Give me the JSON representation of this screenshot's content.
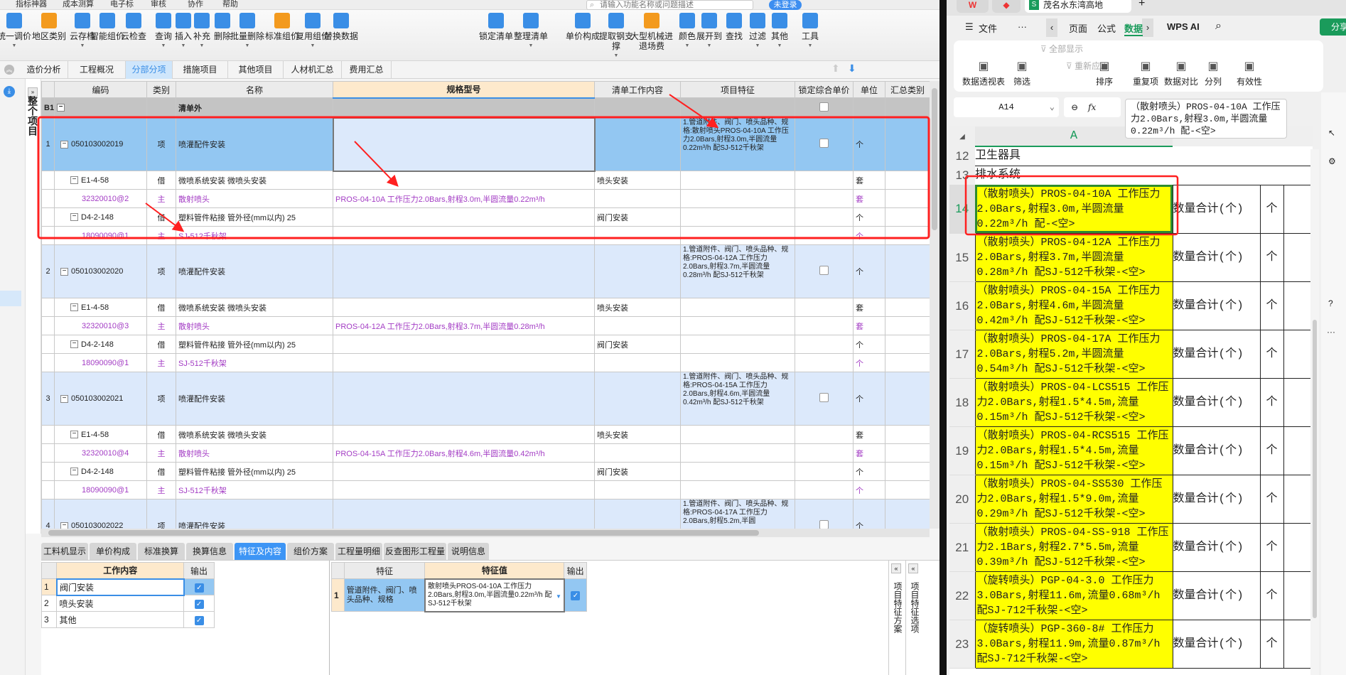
{
  "app": {
    "menu": [
      "指标神器",
      "成本测算",
      "电子标",
      "审核",
      "协作",
      "帮助"
    ],
    "search_placeholder": "请输入功能名称或问题描述",
    "login_label": "未登录",
    "toolbar": [
      "统一调价",
      "地区类别",
      "云存档",
      "智能组价",
      "云检查",
      "查询",
      "插入",
      "补充",
      "删除",
      "批量删除",
      "标准组价",
      "复用组价",
      "替换数据",
      "锁定清单",
      "整理清单",
      "单价构成",
      "提取钢支撑",
      "大型机械进退场费",
      "颜色",
      "展开到",
      "查找",
      "过滤",
      "其他",
      "工具"
    ],
    "tabs": [
      "造价分析",
      "工程概况",
      "分部分项",
      "措施项目",
      "其他项目",
      "人材机汇总",
      "费用汇总"
    ],
    "active_tab": "分部分项",
    "side_label": "整个项目",
    "grid": {
      "columns": [
        "",
        "编码",
        "类别",
        "名称",
        "规格型号",
        "清单工作内容",
        "项目特征",
        "锁定综合单价",
        "单位",
        "汇总类别"
      ],
      "section": {
        "no": "B1",
        "name": "清单外"
      },
      "items": [
        {
          "no": "1",
          "code": "050103002019",
          "type": "项",
          "name": "喷灌配件安装",
          "feature": "1.管道附件、阀门、喷头品种、规格:散射喷头PROS-04-10A 工作压力2.0Bars,射程3.0m,半圆流量0.22m³/h 配SJ-512千秋架",
          "unit": "个",
          "selected": true,
          "children": [
            {
              "code": "E1-4-58",
              "type": "借",
              "name": "微喷系统安装 微喷头安装",
              "spec": "",
              "work": "喷头安装",
              "unit": "套",
              "main": false
            },
            {
              "code": "32320010@2",
              "type": "主",
              "name": "散射喷头",
              "spec": "PROS-04-10A 工作压力2.0Bars,射程3.0m,半圆流量0.22m³/h",
              "work": "",
              "unit": "套",
              "main": true
            },
            {
              "code": "D4-2-148",
              "type": "借",
              "name": "塑料管件粘接 管外径(mm以内) 25",
              "spec": "",
              "work": "阀门安装",
              "unit": "个",
              "main": false
            },
            {
              "code": "18090090@1",
              "type": "主",
              "name": "SJ-512千秋架",
              "spec": "",
              "work": "",
              "unit": "个",
              "main": true
            }
          ]
        },
        {
          "no": "2",
          "code": "050103002020",
          "type": "项",
          "name": "喷灌配件安装",
          "feature": "1.管道附件、阀门、喷头品种、规格:PROS-04-12A 工作压力2.0Bars,射程3.7m,半圆流量0.28m³/h 配SJ-512千秋架",
          "unit": "个",
          "selected": false,
          "children": [
            {
              "code": "E1-4-58",
              "type": "借",
              "name": "微喷系统安装 微喷头安装",
              "spec": "",
              "work": "喷头安装",
              "unit": "套",
              "main": false
            },
            {
              "code": "32320010@3",
              "type": "主",
              "name": "散射喷头",
              "spec": "PROS-04-12A 工作压力2.0Bars,射程3.7m,半圆流量0.28m³/h",
              "work": "",
              "unit": "套",
              "main": true
            },
            {
              "code": "D4-2-148",
              "type": "借",
              "name": "塑料管件粘接 管外径(mm以内) 25",
              "spec": "",
              "work": "阀门安装",
              "unit": "个",
              "main": false
            },
            {
              "code": "18090090@1",
              "type": "主",
              "name": "SJ-512千秋架",
              "spec": "",
              "work": "",
              "unit": "个",
              "main": true
            }
          ]
        },
        {
          "no": "3",
          "code": "050103002021",
          "type": "项",
          "name": "喷灌配件安装",
          "feature": "1.管道附件、阀门、喷头品种、规格:PROS-04-15A 工作压力2.0Bars,射程4.6m,半圆流量0.42m³/h 配SJ-512千秋架",
          "unit": "个",
          "selected": false,
          "children": [
            {
              "code": "E1-4-58",
              "type": "借",
              "name": "微喷系统安装 微喷头安装",
              "spec": "",
              "work": "喷头安装",
              "unit": "套",
              "main": false
            },
            {
              "code": "32320010@4",
              "type": "主",
              "name": "散射喷头",
              "spec": "PROS-04-15A 工作压力2.0Bars,射程4.6m,半圆流量0.42m³/h",
              "work": "",
              "unit": "套",
              "main": true
            },
            {
              "code": "D4-2-148",
              "type": "借",
              "name": "塑料管件粘接 管外径(mm以内) 25",
              "spec": "",
              "work": "阀门安装",
              "unit": "个",
              "main": false
            },
            {
              "code": "18090090@1",
              "type": "主",
              "name": "SJ-512千秋架",
              "spec": "",
              "work": "",
              "unit": "个",
              "main": true
            }
          ]
        },
        {
          "no": "4",
          "code": "050103002022",
          "type": "项",
          "name": "喷灌配件安装",
          "feature": "1.管道附件、阀门、喷头品种、规格:PROS-04-17A 工作压力2.0Bars,射程5.2m,半圆",
          "unit": "个",
          "selected": false,
          "children": []
        }
      ]
    },
    "bottom_tabs": [
      "工料机显示",
      "单价构成",
      "标准换算",
      "换算信息",
      "特征及内容",
      "组价方案",
      "工程量明细",
      "反查图形工程量",
      "说明信息"
    ],
    "active_bottom_tab": "特征及内容",
    "work_table": {
      "headers": [
        "工作内容",
        "输出"
      ],
      "rows": [
        {
          "no": "1",
          "text": "阀门安装",
          "checked": true
        },
        {
          "no": "2",
          "text": "喷头安装",
          "checked": true
        },
        {
          "no": "3",
          "text": "其他",
          "checked": true
        }
      ]
    },
    "feature_table": {
      "headers": [
        "特征",
        "特征值",
        "输出"
      ],
      "rows": [
        {
          "no": "1",
          "feature": "管道附件、阀门、喷头品种、规格",
          "value": "散射喷头PROS-04-10A 工作压力2.0Bars,射程3.0m,半圆流量0.22m³/h 配SJ-512千秋架",
          "checked": true
        }
      ]
    },
    "side_panels": [
      "项目特征方案",
      "项目特征选项"
    ]
  },
  "wps": {
    "doc_tab": "茂名水东湾高地",
    "ribbon_tabs": [
      "文件",
      "页面",
      "公式",
      "数据",
      "WPS AI"
    ],
    "active_ribbon_tab": "数据",
    "ribbon": [
      "数据透视表",
      "筛选",
      "全部显示",
      "重新应用",
      "排序",
      "重复项",
      "数据对比",
      "分列",
      "有效性"
    ],
    "share_label": "分享",
    "name_box": "A14",
    "fx": "fx",
    "formula": "（散射喷头）PROS-04-10A 工作压力2.0Bars,射程3.0m,半圆流量0.22m³/h 配-<空>",
    "col_header": "A",
    "rows": [
      {
        "n": "12",
        "a": "卫生器具",
        "b": "",
        "c": "",
        "title": true
      },
      {
        "n": "13",
        "a": "排水系统",
        "b": "",
        "c": "",
        "title": true
      },
      {
        "n": "14",
        "a": "（散射喷头）PROS-04-10A 工作压力2.0Bars,射程3.0m,半圆流量0.22m³/h 配-<空>",
        "b": "数量合计(个)",
        "c": "个"
      },
      {
        "n": "15",
        "a": "（散射喷头）PROS-04-12A 工作压力2.0Bars,射程3.7m,半圆流量0.28m³/h 配SJ-512千秋架-<空>",
        "b": "数量合计(个)",
        "c": "个"
      },
      {
        "n": "16",
        "a": "（散射喷头）PROS-04-15A 工作压力2.0Bars,射程4.6m,半圆流量0.42m³/h 配SJ-512千秋架-<空>",
        "b": "数量合计(个)",
        "c": "个"
      },
      {
        "n": "17",
        "a": "（散射喷头）PROS-04-17A 工作压力2.0Bars,射程5.2m,半圆流量0.54m³/h 配SJ-512千秋架-<空>",
        "b": "数量合计(个)",
        "c": "个"
      },
      {
        "n": "18",
        "a": "（散射喷头）PROS-04-LCS515 工作压力2.0Bars,射程1.5*4.5m,流量0.15m³/h 配SJ-512千秋架-<空>",
        "b": "数量合计(个)",
        "c": "个"
      },
      {
        "n": "19",
        "a": "（散射喷头）PROS-04-RCS515 工作压力2.0Bars,射程1.5*4.5m,流量0.15m³/h 配SJ-512千秋架-<空>",
        "b": "数量合计(个)",
        "c": "个"
      },
      {
        "n": "20",
        "a": "（散射喷头）PROS-04-SS530 工作压力2.0Bars,射程1.5*9.0m,流量0.29m³/h 配SJ-512千秋架-<空>",
        "b": "数量合计(个)",
        "c": "个"
      },
      {
        "n": "21",
        "a": "（散射喷头）PROS-04-SS-918 工作压力2.1Bars,射程2.7*5.5m,流量0.39m³/h 配SJ-512千秋架-<空>",
        "b": "数量合计(个)",
        "c": "个"
      },
      {
        "n": "22",
        "a": "（旋转喷头）PGP-04-3.0 工作压力3.0Bars,射程11.6m,流量0.68m³/h 配SJ-712千秋架-<空>",
        "b": "数量合计(个)",
        "c": "个"
      },
      {
        "n": "23",
        "a": "（旋转喷头）PGP-360-8# 工作压力3.0Bars,射程11.9m,流量0.87m³/h 配SJ-712千秋架-<空>",
        "b": "数量合计(个)",
        "c": "个"
      }
    ]
  },
  "colors": {
    "accent": "#3a8ee6",
    "selected_row": "#93c7f2",
    "item_row": "#dce9fb",
    "main_material": "#a33cc4",
    "highlight": "#ffff00",
    "annotation": "#ff2020",
    "wps_green": "#1a9b5b"
  }
}
